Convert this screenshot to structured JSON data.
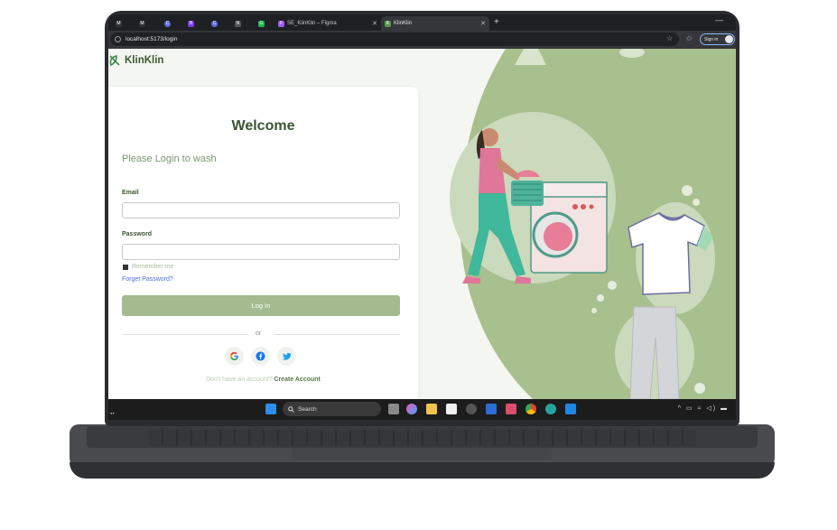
{
  "browser": {
    "tabs": [
      {
        "label": "",
        "favicon": "M",
        "color": "#333333"
      },
      {
        "label": "",
        "favicon": "M",
        "color": "#333333"
      },
      {
        "label": "",
        "favicon": "C",
        "color": "#5b6ee1"
      },
      {
        "label": "",
        "favicon": "B",
        "color": "#7c3aed"
      },
      {
        "label": "",
        "favicon": "C",
        "color": "#5b6ee1"
      },
      {
        "label": "",
        "favicon": "N",
        "color": "#555555"
      },
      {
        "label": "",
        "favicon": "G",
        "color": "#1db954"
      },
      {
        "label": "SE_KlinKlin – Figma",
        "favicon": "F",
        "color": "#a259ff"
      },
      {
        "label": "KlinKlin",
        "favicon": "K",
        "color": "#5a9a4a"
      }
    ],
    "url": "localhost:5173/login",
    "signin_label": "Sign in"
  },
  "app": {
    "brand": "KlinKlin",
    "welcome": "Welcome",
    "subtitle": "Please Login to wash",
    "email_label": "Email",
    "email_value": "",
    "password_label": "Password",
    "password_value": "",
    "remember_label": "Remember me",
    "forget_label": "Forget Password?",
    "login_label": "Log In",
    "or_label": "or",
    "signup_text": "Don't have an account?",
    "signup_link": "Create Account",
    "social": [
      "google-icon",
      "facebook-icon",
      "twitter-icon"
    ]
  },
  "taskbar": {
    "search_label": "Search"
  },
  "colors": {
    "brand_green": "#3b5334",
    "button_green": "#a3bb8e",
    "illustration_green": "#a8bf8e",
    "link_blue": "#4f6fe0"
  }
}
